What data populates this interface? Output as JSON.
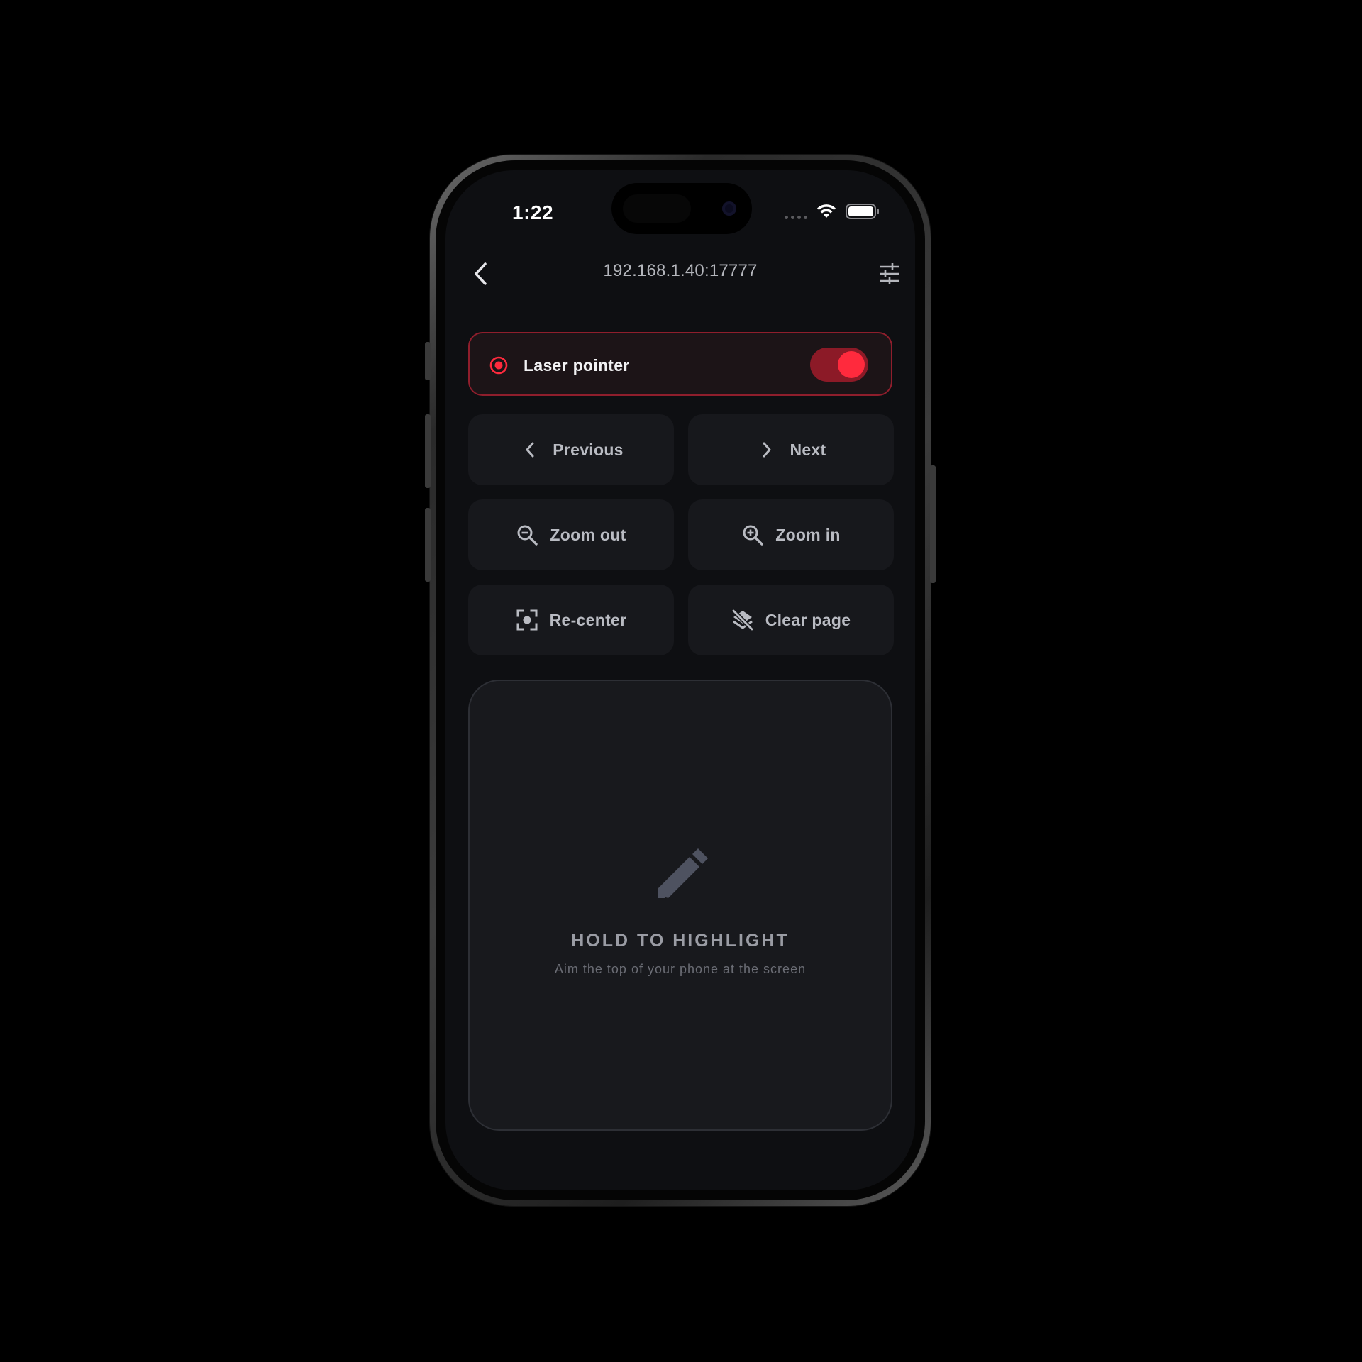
{
  "status_bar": {
    "time": "1:22"
  },
  "nav": {
    "title": "192.168.1.40:17777"
  },
  "laser": {
    "label": "Laser pointer",
    "enabled": true
  },
  "controls": {
    "previous": "Previous",
    "next": "Next",
    "zoom_out": "Zoom out",
    "zoom_in": "Zoom in",
    "recenter": "Re-center",
    "clear_page": "Clear page"
  },
  "touchpad": {
    "title": "HOLD TO HIGHLIGHT",
    "subtitle": "Aim the top of your phone at the screen"
  },
  "colors": {
    "accent": "#ff2a3d",
    "background": "#0e0f12",
    "surface": "#17181c"
  },
  "icons": {
    "back": "chevron-left-icon",
    "settings": "tune-icon",
    "laser": "radio-target-icon",
    "previous": "chevron-left-icon",
    "next": "chevron-right-icon",
    "zoom_out": "zoom-out-icon",
    "zoom_in": "zoom-in-icon",
    "recenter": "center-focus-icon",
    "clear_page": "layers-clear-icon",
    "touchpad": "pencil-icon"
  }
}
